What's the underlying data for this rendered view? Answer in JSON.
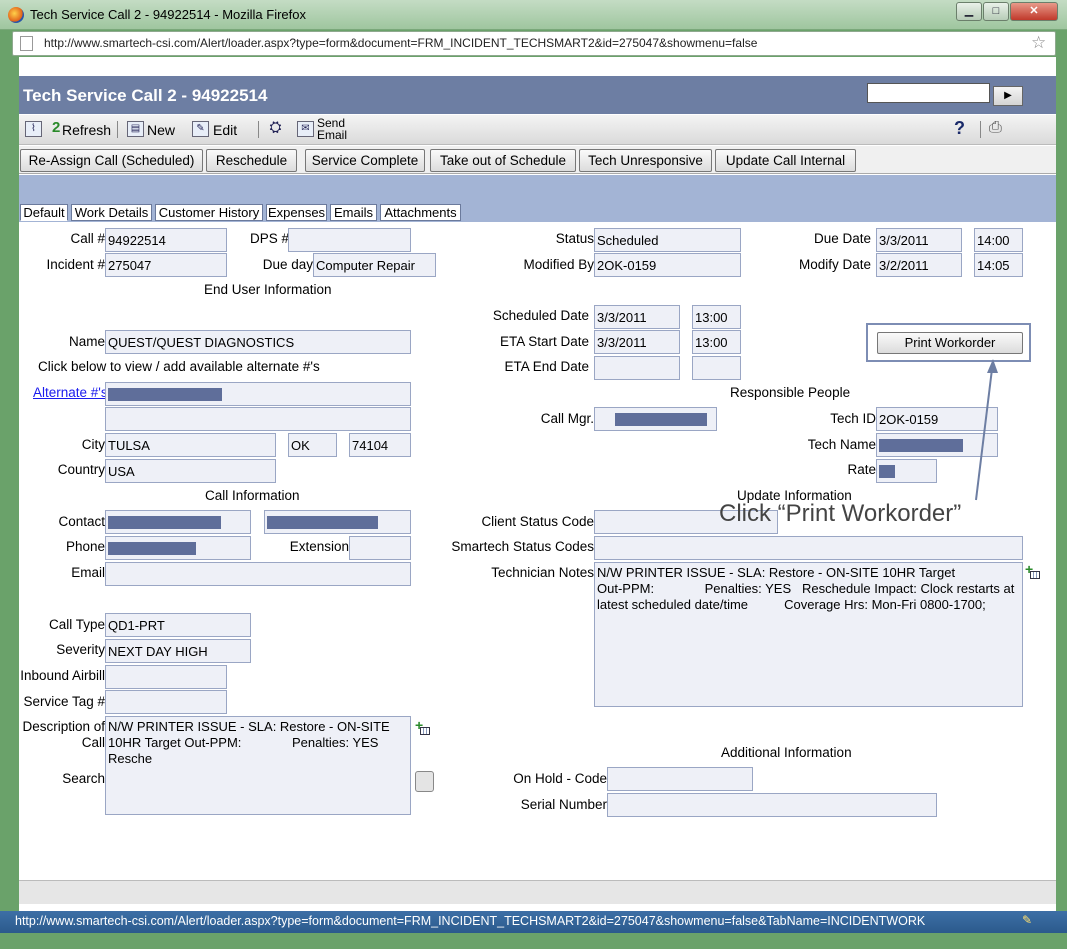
{
  "window": {
    "title": "Tech Service Call 2 - 94922514 - Mozilla Firefox",
    "minimize": "▁",
    "maximize": "□",
    "close": "✕",
    "url": "http://www.smartech-csi.com/Alert/loader.aspx?type=form&document=FRM_INCIDENT_TECHSMART2&id=275047&showmenu=false",
    "status_url": "http://www.smartech-csi.com/Alert/loader.aspx?type=form&document=FRM_INCIDENT_TECHSMART2&id=275047&showmenu=false&TabName=INCIDENTWORK"
  },
  "header": {
    "title": "Tech Service Call 2 - 94922514",
    "search_value": "",
    "go_label": "▶"
  },
  "toolbar": {
    "refresh": "Refresh",
    "new": "New",
    "edit": "Edit",
    "send_email_1": "Send",
    "send_email_2": "Email",
    "help": "?"
  },
  "actions": [
    "Re-Assign Call (Scheduled)",
    "Reschedule",
    "Service Complete",
    "Take out of Schedule",
    "Tech Unresponsive",
    "Update Call Internal"
  ],
  "tabs": [
    "Default",
    "Work Details",
    "Customer History",
    "Expenses",
    "Emails",
    "Attachments"
  ],
  "labels": {
    "call_no": "Call #",
    "dps_no": "DPS #",
    "incident_no": "Incident #",
    "due_day": "Due day",
    "end_user_info": "End User Information",
    "name": "Name",
    "alt_hint": "Click below to view / add available alternate #'s",
    "alternate": "Alternate #'s",
    "city": "City",
    "country": "Country",
    "call_info": "Call Information",
    "contact": "Contact",
    "phone": "Phone",
    "extension": "Extension",
    "email": "Email",
    "call_type": "Call Type",
    "severity": "Severity",
    "inbound_airbill": "Inbound Airbill",
    "service_tag": "Service Tag #",
    "description_1": "Description of",
    "description_2": "Call",
    "search": "Search",
    "status": "Status",
    "due_date": "Due Date",
    "modified_by": "Modified By",
    "modify_date": "Modify Date",
    "scheduled_date": "Scheduled Date",
    "eta_start": "ETA Start Date",
    "eta_end": "ETA End Date",
    "responsible": "Responsible People",
    "call_mgr": "Call Mgr.",
    "tech_id": "Tech ID",
    "tech_name": "Tech Name",
    "rate": "Rate",
    "update_info": "Update Information",
    "client_status": "Client Status Code",
    "smartech_status": "Smartech Status Codes",
    "tech_notes": "Technician Notes",
    "additional_info": "Additional Information",
    "on_hold": "On Hold - Code",
    "serial": "Serial Number"
  },
  "values": {
    "call_no": "94922514",
    "dps_no": "",
    "incident_no": "275047",
    "due_day": "Computer Repair",
    "name": "QUEST/QUEST DIAGNOSTICS",
    "city": "TULSA",
    "state": "OK",
    "zip": "74104",
    "country": "USA",
    "call_type": "QD1-PRT",
    "severity": "NEXT DAY HIGH",
    "description": "N/W PRINTER ISSUE - SLA: Restore - ON-SITE\n10HR Target Out-PPM:              Penalties: YES\nResche",
    "status": "Scheduled",
    "due_date": "3/3/2011",
    "due_time": "14:00",
    "modified_by": "2OK-0159",
    "modify_date": "3/2/2011",
    "modify_time": "14:05",
    "scheduled_date": "3/3/2011",
    "scheduled_time": "13:00",
    "eta_start_date": "3/3/2011",
    "eta_start_time": "13:00",
    "tech_id": "2OK-0159",
    "tech_notes": "N/W PRINTER ISSUE - SLA: Restore - ON-SITE 10HR Target\nOut-PPM:              Penalties: YES   Reschedule Impact: Clock restarts at\nlatest scheduled date/time          Coverage Hrs: Mon-Fri 0800-1700;"
  },
  "print_button": "Print Workorder",
  "callout": "Click “Print Workorder”"
}
